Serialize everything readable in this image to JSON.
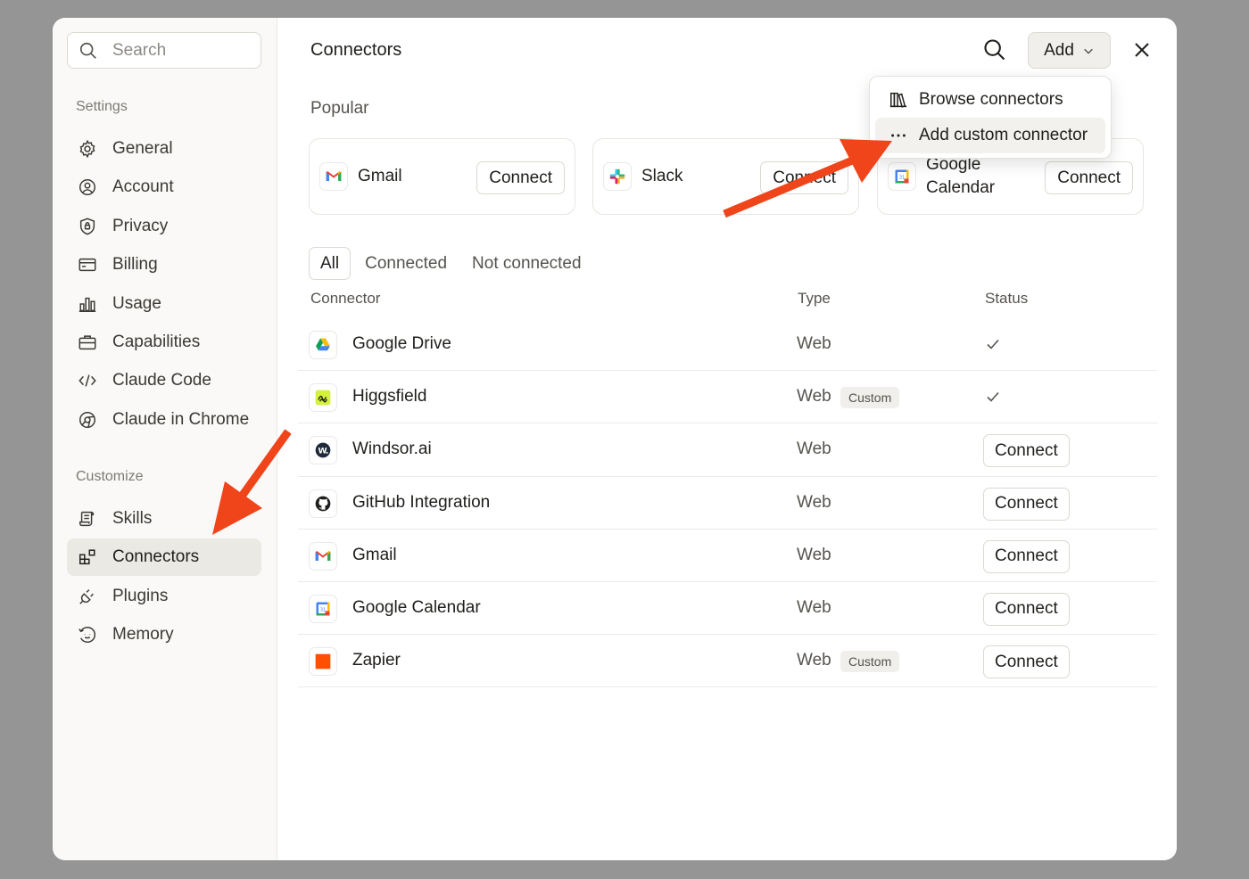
{
  "sidebar": {
    "search_placeholder": "Search",
    "settings_label": "Settings",
    "settings_items": [
      {
        "label": "General",
        "icon": "gear-icon"
      },
      {
        "label": "Account",
        "icon": "user-circle-icon"
      },
      {
        "label": "Privacy",
        "icon": "shield-icon"
      },
      {
        "label": "Billing",
        "icon": "card-icon"
      },
      {
        "label": "Usage",
        "icon": "bar-chart-icon"
      },
      {
        "label": "Capabilities",
        "icon": "briefcase-icon"
      },
      {
        "label": "Claude Code",
        "icon": "code-icon"
      },
      {
        "label": "Claude in Chrome",
        "icon": "globe-icon"
      }
    ],
    "customize_label": "Customize",
    "customize_items": [
      {
        "label": "Skills",
        "icon": "scroll-icon"
      },
      {
        "label": "Connectors",
        "icon": "grid-plus-icon",
        "active": true
      },
      {
        "label": "Plugins",
        "icon": "plug-icon"
      },
      {
        "label": "Memory",
        "icon": "memory-icon"
      }
    ]
  },
  "header": {
    "title": "Connectors",
    "add_label": "Add"
  },
  "menu": {
    "items": [
      {
        "label": "Browse connectors",
        "icon": "books-icon"
      },
      {
        "label": "Add custom connector",
        "icon": "ellipsis-icon",
        "highlighted": true
      }
    ]
  },
  "popular": {
    "label": "Popular",
    "cards": [
      {
        "name": "Gmail",
        "button": "Connect"
      },
      {
        "name": "Slack",
        "button": "Connect"
      },
      {
        "name": "Google Calendar",
        "button": "Connect"
      }
    ]
  },
  "filters": [
    "All",
    "Connected",
    "Not connected"
  ],
  "table": {
    "headers": {
      "connector": "Connector",
      "type": "Type",
      "status": "Status"
    },
    "rows": [
      {
        "name": "Google Drive",
        "type": "Web",
        "badge": "",
        "status": "connected"
      },
      {
        "name": "Higgsfield",
        "type": "Web",
        "badge": "Custom",
        "status": "connected"
      },
      {
        "name": "Windsor.ai",
        "type": "Web",
        "badge": "",
        "status": "Connect"
      },
      {
        "name": "GitHub Integration",
        "type": "Web",
        "badge": "",
        "status": "Connect"
      },
      {
        "name": "Gmail",
        "type": "Web",
        "badge": "",
        "status": "Connect"
      },
      {
        "name": "Google Calendar",
        "type": "Web",
        "badge": "",
        "status": "Connect"
      },
      {
        "name": "Zapier",
        "type": "Web",
        "badge": "Custom",
        "status": "Connect"
      }
    ]
  },
  "colors": {
    "annotation_arrow": "#f0441b",
    "active_nav_bg": "#ebe9e4",
    "backdrop": "#959595"
  }
}
